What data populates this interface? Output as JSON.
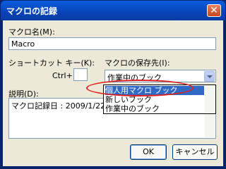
{
  "window": {
    "title": "マクロの記録",
    "close_glyph": "✕"
  },
  "macro_name": {
    "label": "マクロ名(M):",
    "value": "Macro"
  },
  "shortcut": {
    "label": "ショートカット キー(K):",
    "ctrl_label": "Ctrl+",
    "value": ""
  },
  "store_in": {
    "label": "マクロの保存先(I):",
    "value": "作業中のブック",
    "options": [
      "個人用マクロ ブック",
      "新しいブック",
      "作業中のブック"
    ],
    "highlighted_index": 0
  },
  "description": {
    "label": "説明(D):",
    "value": "マクロ記録日 : 2009/1/22"
  },
  "buttons": {
    "ok": "OK",
    "cancel": "キャンセル"
  },
  "colors": {
    "highlight": "#316ac5",
    "annotation": "#e02020",
    "titlebar": "#0842b5"
  }
}
